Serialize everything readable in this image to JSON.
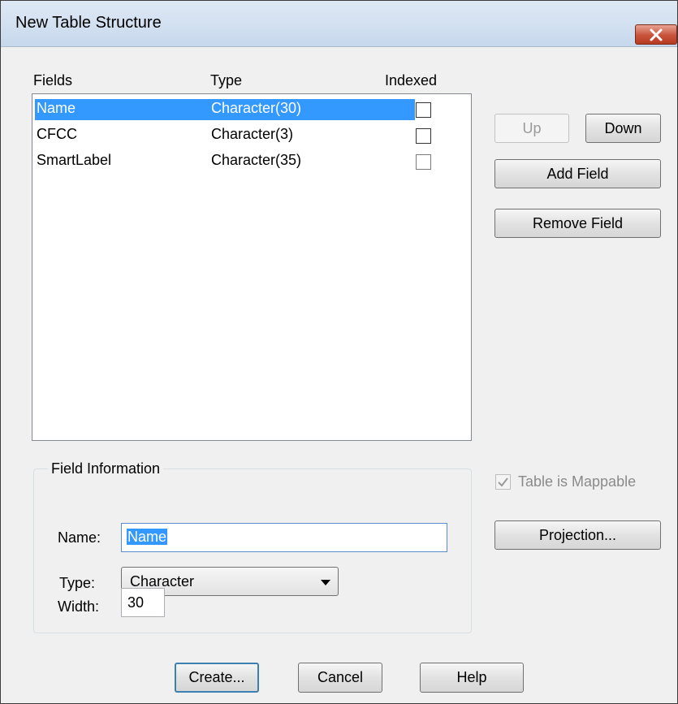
{
  "dialog": {
    "title": "New Table Structure"
  },
  "columns": {
    "fields": "Fields",
    "type": "Type",
    "indexed": "Indexed"
  },
  "fields": [
    {
      "name": "Name",
      "type": "Character(30)",
      "indexed": false,
      "selected": true
    },
    {
      "name": "CFCC",
      "type": "Character(3)",
      "indexed": false,
      "selected": false
    },
    {
      "name": "SmartLabel",
      "type": "Character(35)",
      "indexed": false,
      "selected": false
    }
  ],
  "buttons": {
    "up": "Up",
    "down": "Down",
    "add_field": "Add Field",
    "remove_field": "Remove Field",
    "projection": "Projection...",
    "create": "Create...",
    "cancel": "Cancel",
    "help": "Help"
  },
  "mappable": {
    "label": "Table is Mappable",
    "checked": true,
    "disabled": true
  },
  "field_info": {
    "group_title": "Field Information",
    "name_label": "Name:",
    "name_value": "Name",
    "type_label": "Type:",
    "type_value": "Character",
    "width_label": "Width:",
    "width_value": "30"
  },
  "icons": {
    "close": "close-icon",
    "dropdown": "chevron-down-icon",
    "check": "check-icon"
  },
  "colors": {
    "selection": "#3399ff",
    "close": "#c8523b"
  }
}
